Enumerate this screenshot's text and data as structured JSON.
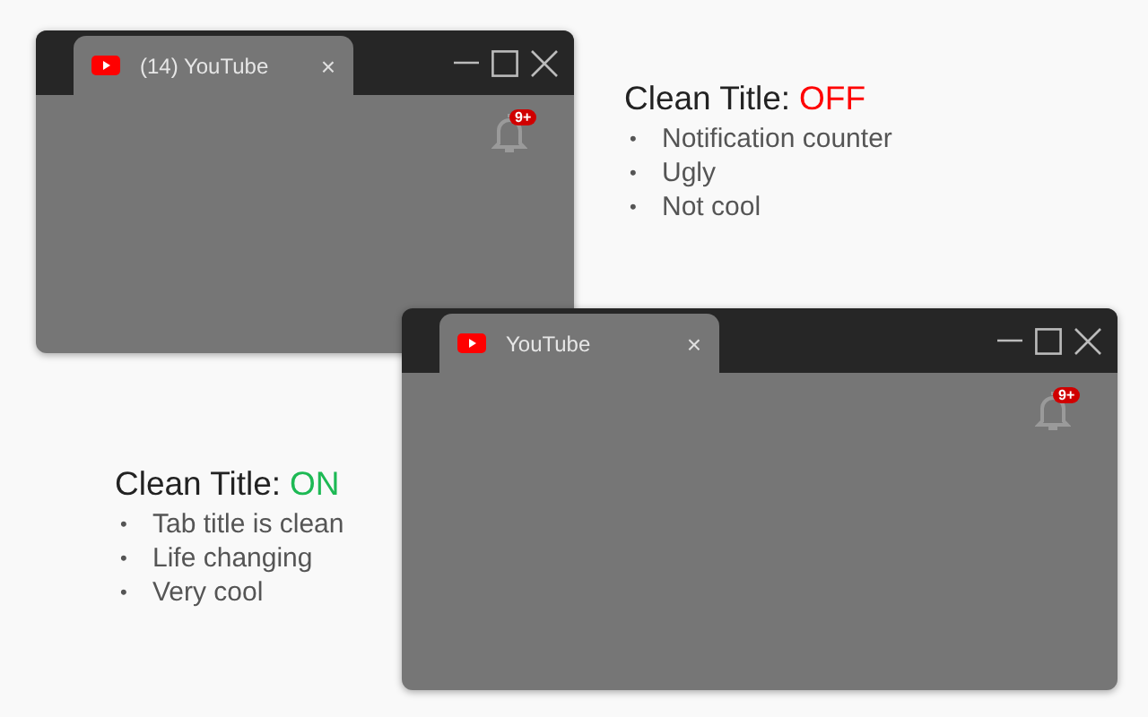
{
  "windows": [
    {
      "tab_title": "(14) YouTube",
      "tab_close": "×",
      "badge": "9+"
    },
    {
      "tab_title": "YouTube",
      "tab_close": "×",
      "badge": "9+"
    }
  ],
  "captions": [
    {
      "label": "Clean Title:",
      "value": "OFF",
      "on": false,
      "items": [
        {
          "bullet": "•",
          "text": "Notification counter"
        },
        {
          "bullet": "•",
          "text": "Ugly"
        },
        {
          "bullet": "•",
          "text": "Not cool"
        }
      ]
    },
    {
      "label": "Clean Title:",
      "value": "ON",
      "on": true,
      "items": [
        {
          "bullet": "•",
          "text": "Tab title is clean"
        },
        {
          "bullet": "•",
          "text": "Life changing"
        },
        {
          "bullet": "•",
          "text": "Very cool"
        }
      ]
    }
  ]
}
